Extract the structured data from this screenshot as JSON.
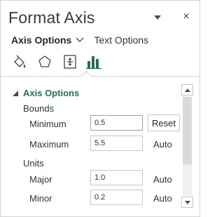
{
  "pane": {
    "title": "Format Axis",
    "dropdown_icon": "chevron-down-icon",
    "close_label": "×"
  },
  "options": {
    "axis_options_label": "Axis Options",
    "text_options_label": "Text Options"
  },
  "categories": [
    {
      "name": "fill-line",
      "icon": "paint-bucket-icon"
    },
    {
      "name": "effects",
      "icon": "pentagon-icon"
    },
    {
      "name": "size-properties",
      "icon": "size-properties-icon"
    },
    {
      "name": "axis-options",
      "icon": "bar-chart-icon",
      "selected": true
    }
  ],
  "section": {
    "title": "Axis Options",
    "bounds_label": "Bounds",
    "minimum_label": "Minimum",
    "minimum_value": "0.5",
    "reset_label": "Reset",
    "maximum_label": "Maximum",
    "maximum_value": "5.5",
    "maximum_state": "Auto",
    "units_label": "Units",
    "major_label": "Major",
    "major_value": "1.0",
    "major_state": "Auto",
    "minor_label": "Minor",
    "minor_value": "0.2",
    "minor_state": "Auto"
  },
  "colors": {
    "accent": "#217346",
    "border": "#c6c6c6"
  }
}
